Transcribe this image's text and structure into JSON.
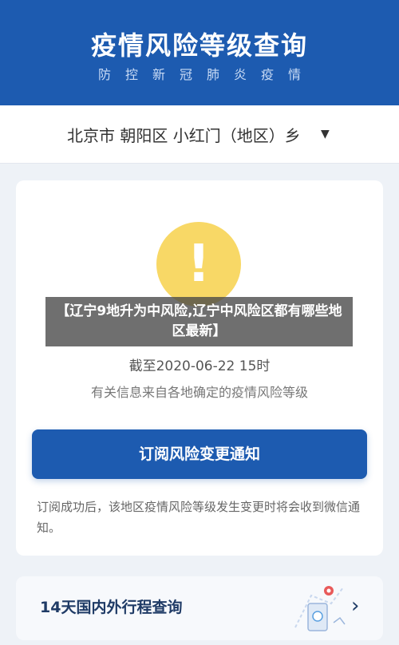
{
  "header": {
    "title": "疫情风险等级查询",
    "subtitle": "防控新冠肺炎疫情"
  },
  "location": {
    "path": "北京市 朝阳区 小红门（地区）乡",
    "caret_icon": "caret-down-icon"
  },
  "risk": {
    "icon": "exclamation-icon",
    "icon_color": "#f8d866",
    "as_of": "截至2020-06-22 15时",
    "source_note": "有关信息来自各地确定的疫情风险等级"
  },
  "overlay": {
    "text": "【辽宁9地升为中风险,辽宁中风险区都有哪些地区最新】"
  },
  "subscribe": {
    "button_label": "订阅风险变更通知",
    "description": "订阅成功后，该地区疫情风险等级发生变更时将会收到微信通知。"
  },
  "trip": {
    "label": "14天国内外行程查询",
    "illustration_icon": "map-route-icon",
    "arrow_icon": "chevron-right-icon"
  },
  "colors": {
    "brand_blue": "#1d5bb0",
    "background": "#eef2f7"
  }
}
